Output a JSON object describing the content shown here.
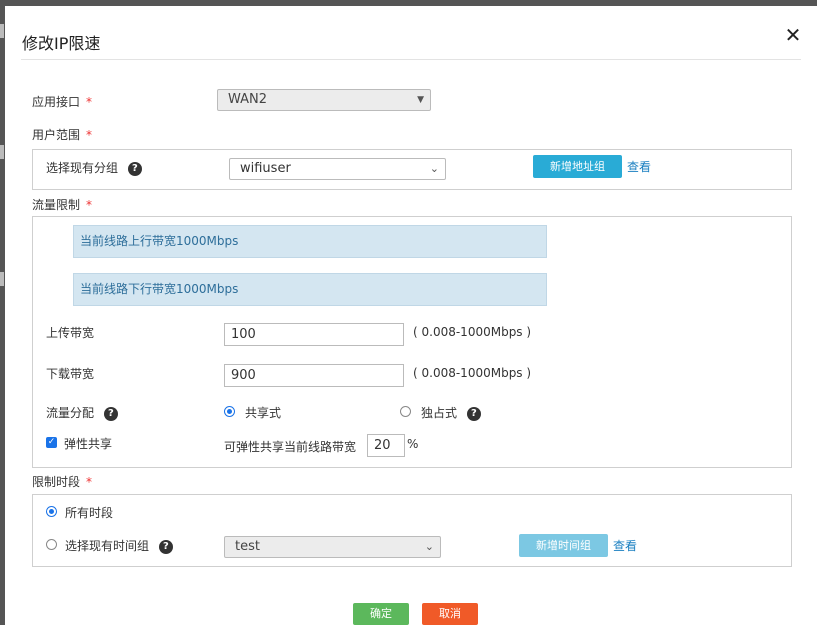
{
  "dialog": {
    "title": "修改IP限速",
    "close_glyph": "✕"
  },
  "interface": {
    "label": "应用接口",
    "required_mark": "*",
    "value": "WAN2"
  },
  "user_scope": {
    "label": "用户范围",
    "required_mark": "*",
    "select_group_label": "选择现有分组",
    "group_value": "wifiuser",
    "add_group_button": "新增地址组",
    "view_link": "查看"
  },
  "traffic": {
    "label": "流量限制",
    "required_mark": "*",
    "uplink_info": "当前线路上行带宽1000Mbps",
    "downlink_info": "当前线路下行带宽1000Mbps",
    "upload_label": "上传带宽",
    "upload_value": "100",
    "upload_range": "( 0.008-1000Mbps )",
    "download_label": "下载带宽",
    "download_value": "900",
    "download_range": "( 0.008-1000Mbps )",
    "allocation_label": "流量分配",
    "shared_label": "共享式",
    "exclusive_label": "独占式",
    "elastic_label": "弹性共享",
    "elastic_share_label": "可弹性共享当前线路带宽",
    "elastic_value": "20",
    "percent": "%"
  },
  "schedule": {
    "label": "限制时段",
    "required_mark": "*",
    "all_time_label": "所有时段",
    "select_time_group_label": "选择现有时间组",
    "time_group_value": "test",
    "add_time_group_button": "新增时间组",
    "view_link": "查看"
  },
  "footer": {
    "ok": "确定",
    "cancel": "取消"
  },
  "colors": {
    "accent": "#29abd6",
    "ok": "#5cb85c",
    "cancel": "#f05a28",
    "info_bg": "#d4e6f1"
  }
}
